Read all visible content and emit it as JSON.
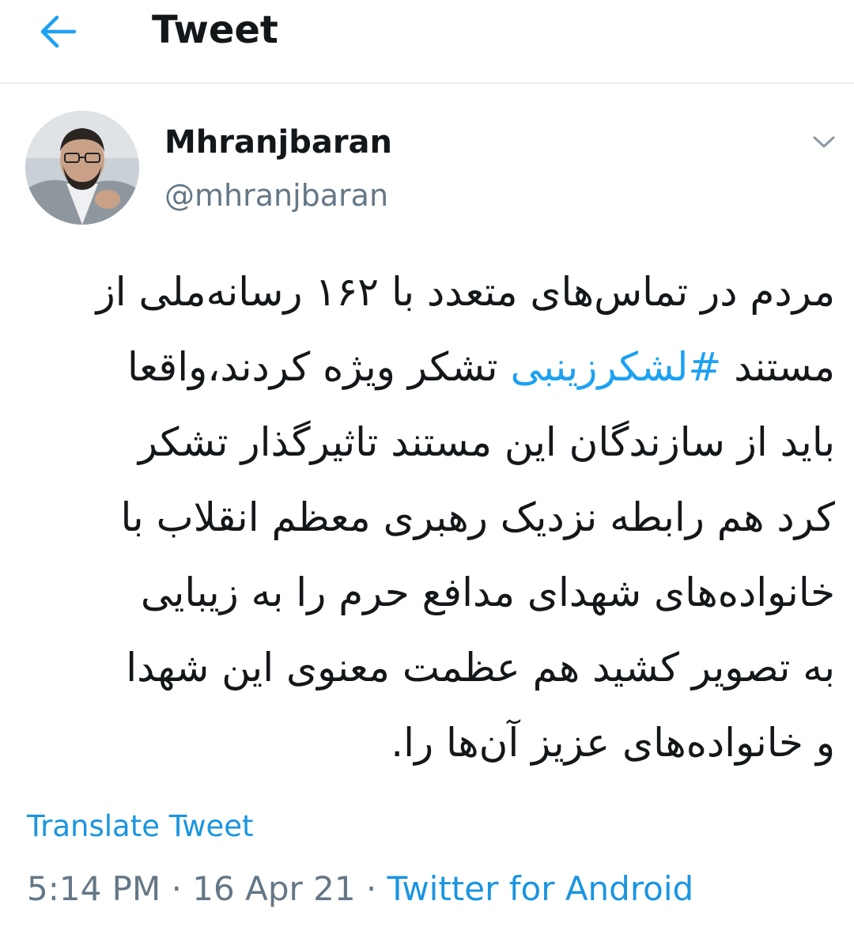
{
  "header": {
    "back_icon": "arrow-left-icon",
    "title": "Tweet",
    "accent_color": "#1da1f2"
  },
  "author": {
    "display_name": "Mhranjbaran",
    "handle": "@mhranjbaran",
    "menu_icon": "chevron-down-icon"
  },
  "tweet": {
    "lines": [
      "مردم در تماس‌های متعدد با ۱۶۲ رسانه‌ملی از",
      "مستند ",
      "باید از سازندگان این مستند تاثیرگذار تشکر",
      "کرد هم رابطه نزدیک رهبری معظم انقلاب با",
      "خانواده‌های شهدای مدافع حرم را به زیبایی",
      "به تصویر کشید هم عظمت معنوی این شهدا",
      "و خانواده‌های عزیز آن‌ها را."
    ],
    "hashtag": "#لشکرزینبی",
    "line2_tail": " تشکر ویژه کردند،واقعا"
  },
  "translate_label": "Translate Tweet",
  "meta": {
    "time": "5:14 PM",
    "separator": " · ",
    "date": "16 Apr 21",
    "source": "Twitter for Android"
  }
}
